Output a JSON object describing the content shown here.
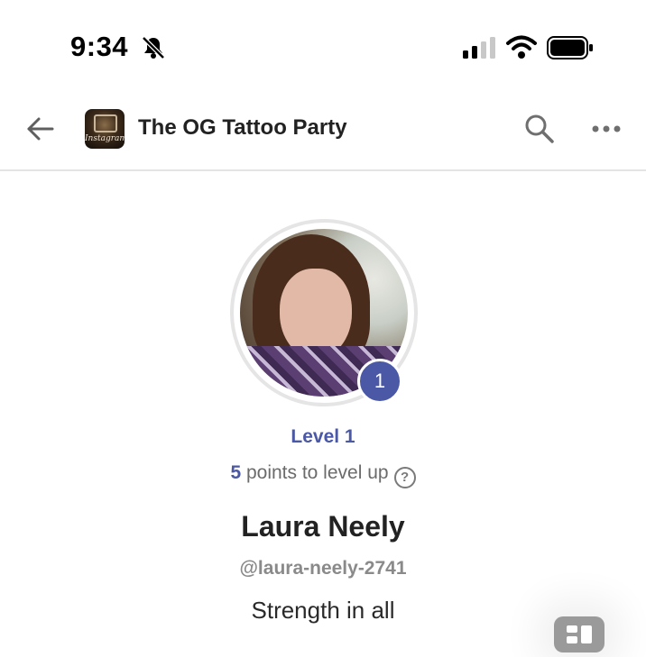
{
  "status_bar": {
    "time": "9:34",
    "icons": [
      "bell-slash-icon",
      "cellular-signal-icon",
      "wifi-icon",
      "battery-icon"
    ]
  },
  "header": {
    "title": "The OG Tattoo Party",
    "thumbnail_caption": "Instagram",
    "icons": [
      "back-arrow-icon",
      "search-icon",
      "more-icon"
    ]
  },
  "profile": {
    "level_badge": "1",
    "level_label": "Level 1",
    "points_value": "5",
    "points_text": " points to level up",
    "help_glyph": "?",
    "name": "Laura Neely",
    "handle": "@laura-neely-2741",
    "bio": "Strength in all"
  },
  "colors": {
    "accent": "#4a58a6",
    "divider": "#e4e4e4",
    "muted": "#8a8a8a"
  }
}
